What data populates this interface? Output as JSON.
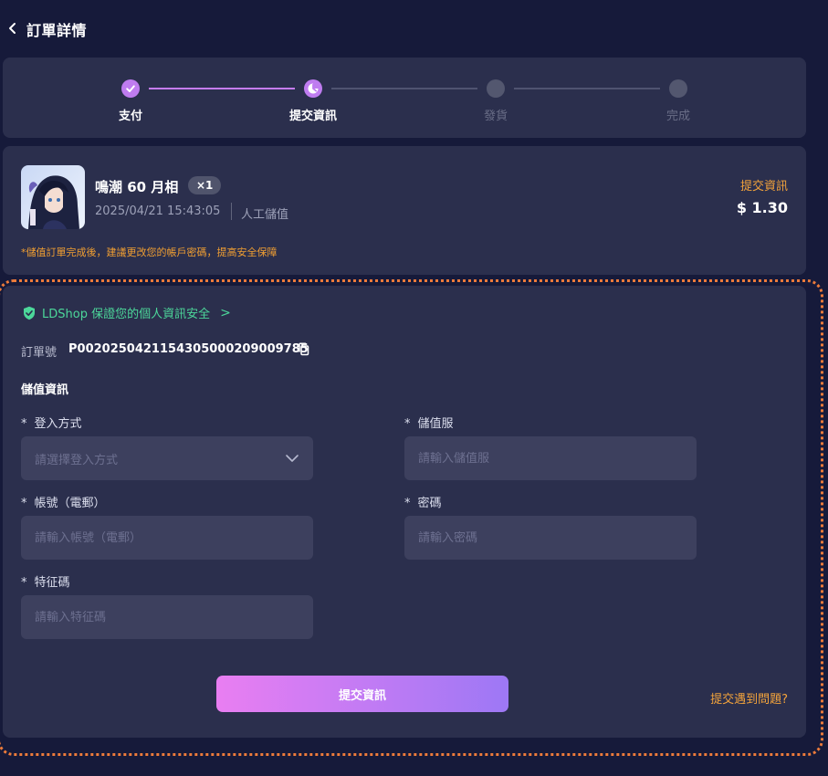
{
  "header": {
    "title": "訂單詳情"
  },
  "steps": [
    {
      "label": "支付",
      "state": "done"
    },
    {
      "label": "提交資訊",
      "state": "active"
    },
    {
      "label": "發貨",
      "state": "pending"
    },
    {
      "label": "完成",
      "state": "pending"
    }
  ],
  "product": {
    "name": "鳴潮 60 月相",
    "quantity": "×1",
    "date": "2025/04/21 15:43:05",
    "type": "人工儲值",
    "status": "提交資訊",
    "price": "$ 1.30",
    "notice": "*儲值訂單完成後，建議更改您的帳戶密碼，提高安全保障"
  },
  "security": {
    "text": "LDShop 保證您的個人資訊安全",
    "chevron": ">"
  },
  "order": {
    "label": "訂單號",
    "number": "P0020250421154305000209009785"
  },
  "recharge": {
    "section_title": "儲值資訊",
    "required_mark": "*",
    "login_method": {
      "label": "登入方式",
      "placeholder": "請選擇登入方式"
    },
    "server": {
      "label": "儲值服",
      "placeholder": "請輸入儲值服"
    },
    "account": {
      "label": "帳號（電郵）",
      "placeholder": "請輸入帳號（電郵）"
    },
    "password": {
      "label": "密碼",
      "placeholder": "請輸入密碼"
    },
    "feature_code": {
      "label": "特征碼",
      "placeholder": "請輸入特征碼"
    }
  },
  "actions": {
    "submit": "提交資訊",
    "help": "提交遇到問題?"
  },
  "colors": {
    "accent_purple": "#bf7cf0",
    "accent_orange": "#f3a33b",
    "secure_green": "#4cd79a",
    "background": "#161a3a",
    "card": "#2b2f4d"
  },
  "icons": {
    "back": "chevron-left-icon",
    "step_done": "check-icon",
    "step_active": "clock-icon",
    "shield": "shield-check-icon",
    "copy": "copy-icon",
    "dropdown": "chevron-down-icon"
  }
}
